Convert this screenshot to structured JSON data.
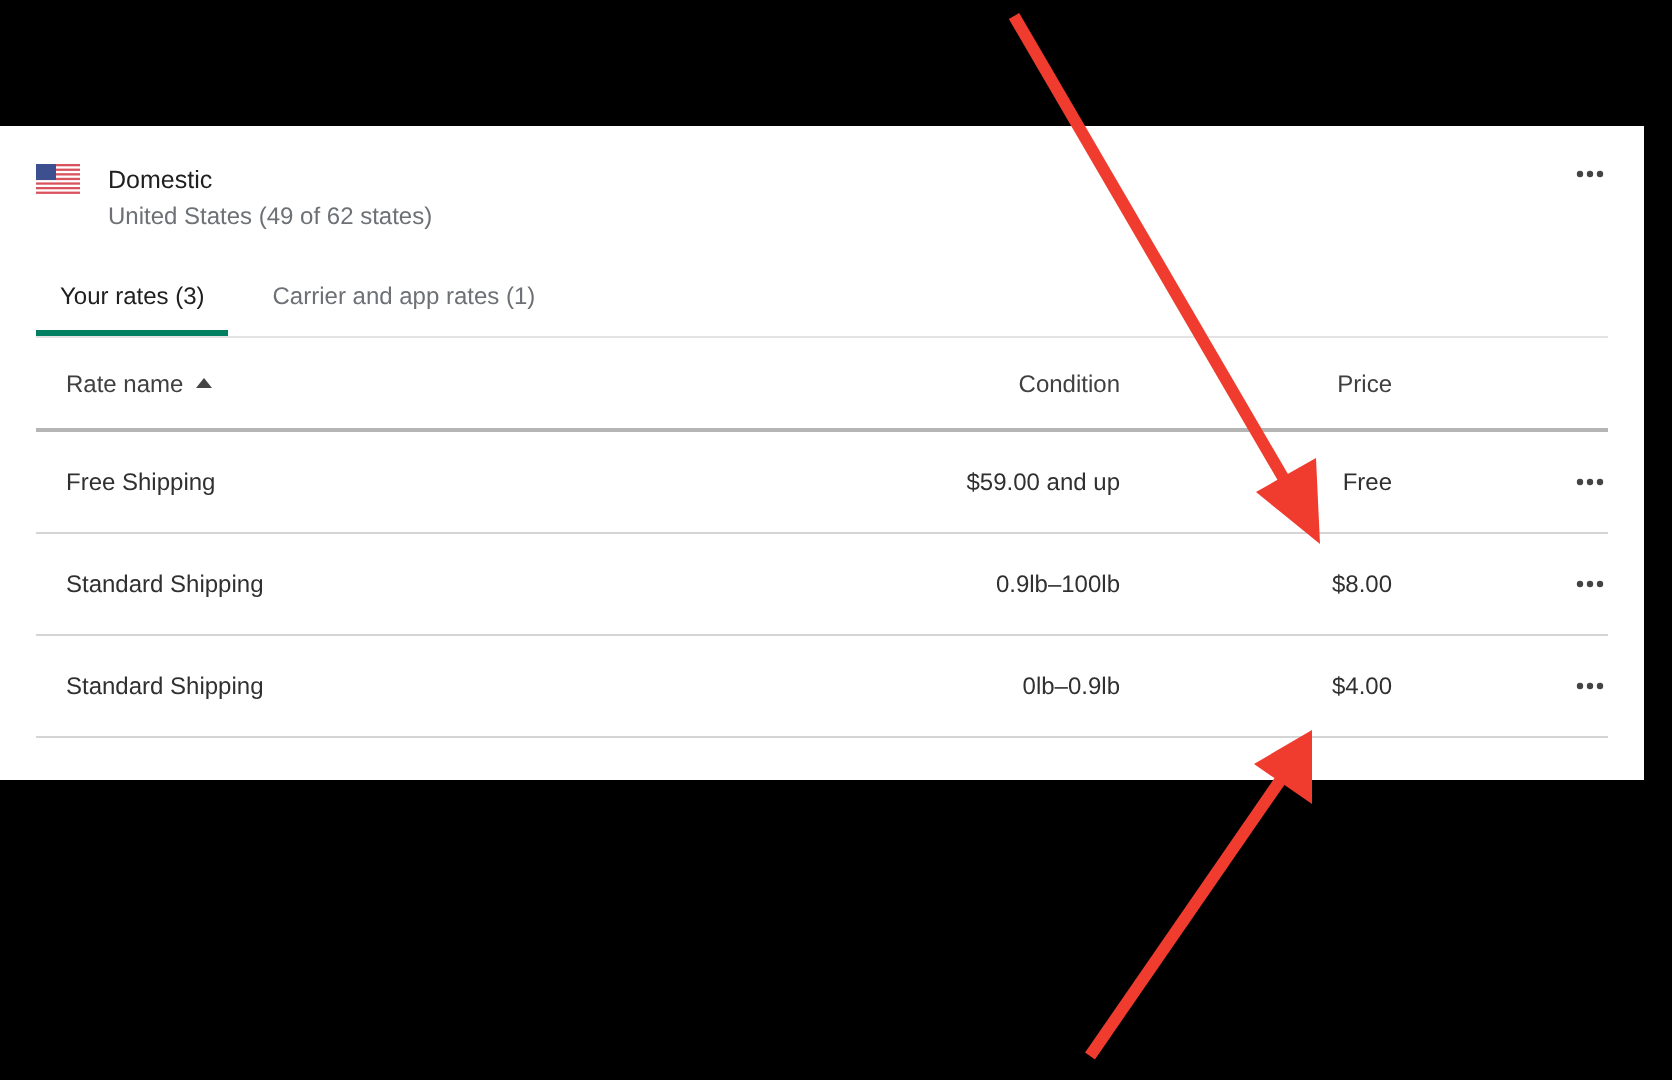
{
  "zone": {
    "title": "Domestic",
    "subtitle": "United States (49 of 62 states)"
  },
  "tabs": [
    {
      "label": "Your rates (3)",
      "selected": true
    },
    {
      "label": "Carrier and app rates (1)",
      "selected": false
    }
  ],
  "table": {
    "columns": [
      {
        "label": "Rate name",
        "sorted": true
      },
      {
        "label": "Condition",
        "sorted": false
      },
      {
        "label": "Price",
        "sorted": false
      }
    ],
    "rows": [
      {
        "name": "Free Shipping",
        "condition": "$59.00 and up",
        "price": "Free"
      },
      {
        "name": "Standard Shipping",
        "condition": "0.9lb–100lb",
        "price": "$8.00"
      },
      {
        "name": "Standard Shipping",
        "condition": "0lb–0.9lb",
        "price": "$4.00"
      }
    ]
  }
}
